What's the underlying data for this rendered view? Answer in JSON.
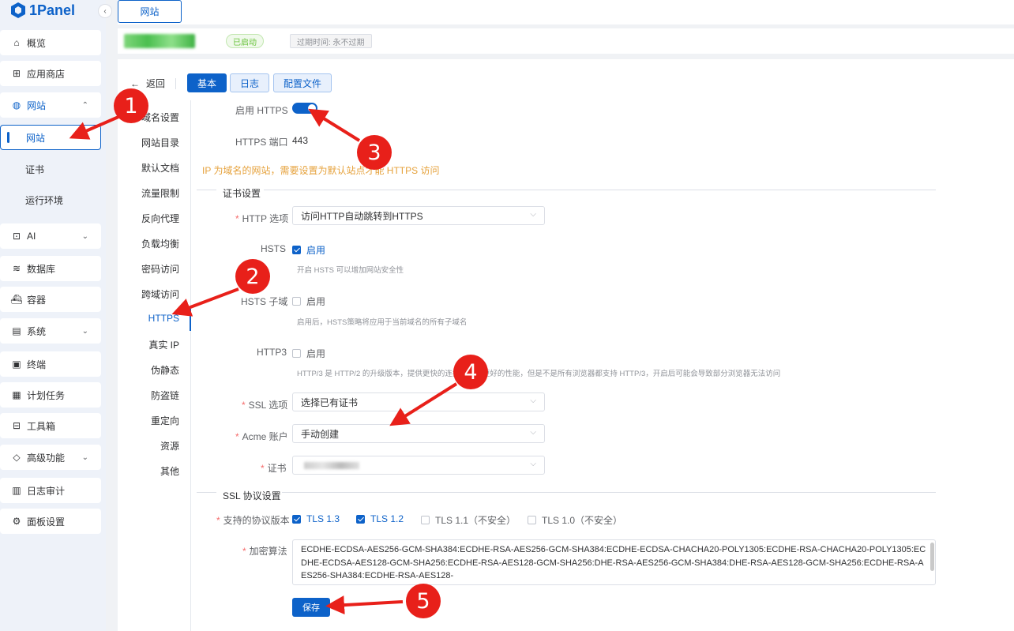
{
  "app": {
    "name": "1Panel"
  },
  "sidebar": {
    "collapse_glyph": "‹",
    "items": [
      {
        "label": "概览",
        "icon": "home-icon",
        "glyph": "⌂"
      },
      {
        "label": "应用商店",
        "icon": "grid-icon",
        "glyph": "⊞"
      },
      {
        "label": "网站",
        "icon": "globe-icon",
        "glyph": "◍",
        "expanded": true
      },
      {
        "label": "AI",
        "icon": "robot-icon",
        "glyph": "⊡"
      },
      {
        "label": "数据库",
        "icon": "layers-icon",
        "glyph": "≋"
      },
      {
        "label": "容器",
        "icon": "container-icon",
        "glyph": "⛴"
      },
      {
        "label": "系统",
        "icon": "server-icon",
        "glyph": "▤"
      },
      {
        "label": "终端",
        "icon": "terminal-icon",
        "glyph": "▣"
      },
      {
        "label": "计划任务",
        "icon": "calendar-icon",
        "glyph": "▦"
      },
      {
        "label": "工具箱",
        "icon": "toolbox-icon",
        "glyph": "⊟"
      },
      {
        "label": "高级功能",
        "icon": "diamond-icon",
        "glyph": "◇"
      },
      {
        "label": "日志审计",
        "icon": "log-icon",
        "glyph": "▥"
      },
      {
        "label": "面板设置",
        "icon": "settings-icon",
        "glyph": "⚙"
      }
    ],
    "sub_items": [
      {
        "label": "网站",
        "active": true
      },
      {
        "label": "证书"
      },
      {
        "label": "运行环境"
      }
    ]
  },
  "tabs": [
    {
      "label": "网站"
    }
  ],
  "status": {
    "state": "已启动",
    "expiry": "过期时间: 永不过期"
  },
  "toolbar": {
    "back": "返回",
    "basic": "基本",
    "log": "日志",
    "config": "配置文件"
  },
  "submenu": [
    "域名设置",
    "网站目录",
    "默认文档",
    "流量限制",
    "反向代理",
    "负载均衡",
    "密码访问",
    "跨域访问",
    "HTTPS",
    "真实 IP",
    "伪静态",
    "防盗链",
    "重定向",
    "资源",
    "其他"
  ],
  "submenu_active_index": 8,
  "form": {
    "https_label": "启用 HTTPS",
    "https_enabled": true,
    "port_label": "HTTPS 端口",
    "port_value": "443",
    "ip_warning": "IP 为域名的网站，需要设置为默认站点才能 HTTPS 访问",
    "cert_section": "证书设置",
    "http_option_label": "HTTP 选项",
    "http_option_value": "访问HTTP自动跳转到HTTPS",
    "hsts_label": "HSTS",
    "hsts_cb": "启用",
    "hsts_hint": "开启 HSTS 可以增加网站安全性",
    "hsts_sub_label": "HSTS 子域",
    "hsts_sub_cb": "启用",
    "hsts_sub_hint": "启用后，HSTS策略将应用于当前域名的所有子域名",
    "http3_label": "HTTP3",
    "http3_cb": "启用",
    "http3_hint": "HTTP/3 是 HTTP/2 的升级版本，提供更快的连接速度和更好的性能，但是不是所有浏览器都支持 HTTP/3，开启后可能会导致部分浏览器无法访问",
    "ssl_option_label": "SSL 选项",
    "ssl_option_value": "选择已有证书",
    "acme_label": "Acme 账户",
    "acme_value": "手动创建",
    "cert_label": "证书",
    "ssl_section": "SSL 协议设置",
    "protocol_label": "支持的协议版本",
    "protocols": [
      {
        "label": "TLS 1.3",
        "checked": true
      },
      {
        "label": "TLS 1.2",
        "checked": true
      },
      {
        "label": "TLS 1.1（不安全）",
        "checked": false
      },
      {
        "label": "TLS 1.0（不安全）",
        "checked": false
      }
    ],
    "cipher_label": "加密算法",
    "cipher_value": "ECDHE-ECDSA-AES256-GCM-SHA384:ECDHE-RSA-AES256-GCM-SHA384:ECDHE-ECDSA-CHACHA20-POLY1305:ECDHE-RSA-CHACHA20-POLY1305:ECDHE-ECDSA-AES128-GCM-SHA256:ECDHE-RSA-AES128-GCM-SHA256:DHE-RSA-AES256-GCM-SHA384:DHE-RSA-AES128-GCM-SHA256:ECDHE-RSA-AES256-SHA384:ECDHE-RSA-AES128-",
    "save": "保存",
    "dropdown_glyph": "⌵"
  },
  "annotations": [
    "1",
    "2",
    "3",
    "4",
    "5"
  ],
  "colors": {
    "primary": "#0d62c9",
    "annotation": "#e8201a",
    "warning": "#e6a23c",
    "success": "#67c23a"
  }
}
